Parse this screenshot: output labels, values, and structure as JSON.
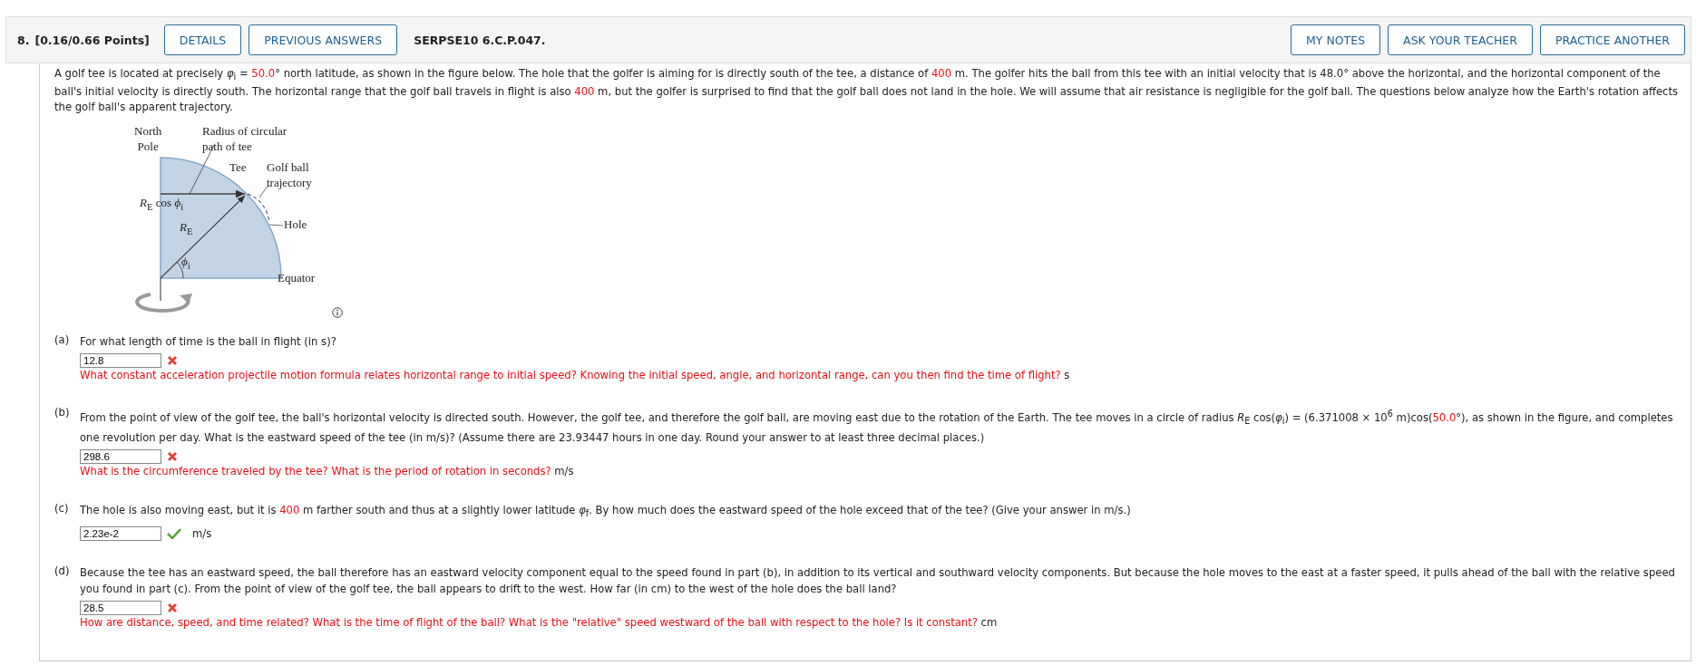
{
  "header": {
    "number": "8.",
    "points": "[0.16/0.66 Points]",
    "left_buttons": [
      "DETAILS",
      "PREVIOUS ANSWERS"
    ],
    "code": "SERPSE10 6.C.P.047.",
    "right_buttons": [
      "MY NOTES",
      "ASK YOUR TEACHER",
      "PRACTICE ANOTHER"
    ]
  },
  "intro": [
    {
      "text": "A golf tee is located at precisely *φ*$_{i}$ = ",
      "red": false
    },
    {
      "text": "50.0",
      "red": true
    },
    {
      "text": "° north latitude, as shown in the figure below. The hole that the golfer is aiming for is directly south of the tee, a distance of ",
      "red": false
    },
    {
      "text": "400",
      "red": true
    },
    {
      "text": " m. The golfer hits the ball from this tee with an initial velocity that is 48.0° above the horizontal, and the horizontal component of the ball's initial velocity is directly south. The horizontal range that the golf ball travels in flight is also ",
      "red": false
    },
    {
      "text": "400",
      "red": true
    },
    {
      "text": " m, but the golfer is surprised to find that the golf ball does not land in the hole. We will assume that air resistance is negligible for the golf ball. The questions below analyze how the Earth's rotation affects the golf ball's apparent trajectory.",
      "red": false
    }
  ],
  "figure": {
    "labels": [
      {
        "lines": [
          "North",
          "Pole"
        ]
      },
      {
        "lines": [
          "Radius of circular",
          "path of tee"
        ]
      },
      {
        "lines": [
          "Tee"
        ]
      },
      {
        "lines": [
          "Golf ball",
          "trajectory"
        ]
      },
      {
        "lines": [
          "*R*$_{E}$ cos *ϕ*$_{i}$"
        ]
      },
      {
        "lines": [
          "*R*$_{E}$"
        ]
      },
      {
        "lines": [
          "Hole"
        ]
      },
      {
        "lines": [
          "*ϕ*$_{i}$"
        ]
      },
      {
        "lines": [
          "Equator"
        ]
      }
    ]
  },
  "parts": [
    {
      "label": "(a)",
      "question": [
        {
          "text": "For what length of time is the ball in flight (in s)?",
          "red": false
        }
      ],
      "answer": "12.8",
      "correct": false,
      "hint": "What constant acceleration projectile motion formula relates horizontal range to initial speed? Knowing the initial speed, angle, and horizontal range, can you then find the time of flight?",
      "unit": "s"
    },
    {
      "label": "(b)",
      "question": [
        {
          "text": "From the point of view of the golf tee, the ball's horizontal velocity is directed south. However, the golf tee, and therefore the golf ball, are moving east due to the rotation of the Earth. The tee moves in a circle of radius *R*$_{E}$ cos(*φ*$_{i}$) = (6.371008 × 10$^{6}$ m)cos(",
          "red": false
        },
        {
          "text": "50.0",
          "red": true
        },
        {
          "text": "°), as shown in the figure, and completes one revolution per day. What is the eastward speed of the tee (in m/s)? (Assume there are 23.93447 hours in one day. Round your answer to at least three decimal places.)",
          "red": false
        }
      ],
      "answer": "298.6",
      "correct": false,
      "hint": "What is the circumference traveled by the tee? What is the period of rotation in seconds?",
      "unit": "m/s"
    },
    {
      "label": "(c)",
      "question": [
        {
          "text": "The hole is also moving east, but it is ",
          "red": false
        },
        {
          "text": "400",
          "red": true
        },
        {
          "text": " m farther south and thus at a slightly lower latitude *φ*$_{f}$. By how much does the eastward speed of the hole exceed that of the tee? (Give your answer in m/s.)",
          "red": false
        }
      ],
      "answer": "2.23e-2",
      "correct": true,
      "unit": "m/s"
    },
    {
      "label": "(d)",
      "question": [
        {
          "text": "Because the tee has an eastward speed, the ball therefore has an eastward velocity component equal to the speed found in part (b), in addition to its vertical and southward velocity components. But because the hole moves to the east at a faster speed, it pulls ahead of the ball with the relative speed you found in part (c). From the point of view of the golf tee, the ball appears to drift to the west. How far (in cm) to the west of the hole does the ball land?",
          "red": false
        }
      ],
      "answer": "28.5",
      "correct": false,
      "hint": "How are distance, speed, and time related? What is the time of flight of the ball? What is the \"relative\" speed westward of the ball with respect to the hole? Is it constant?",
      "unit": "cm"
    }
  ]
}
